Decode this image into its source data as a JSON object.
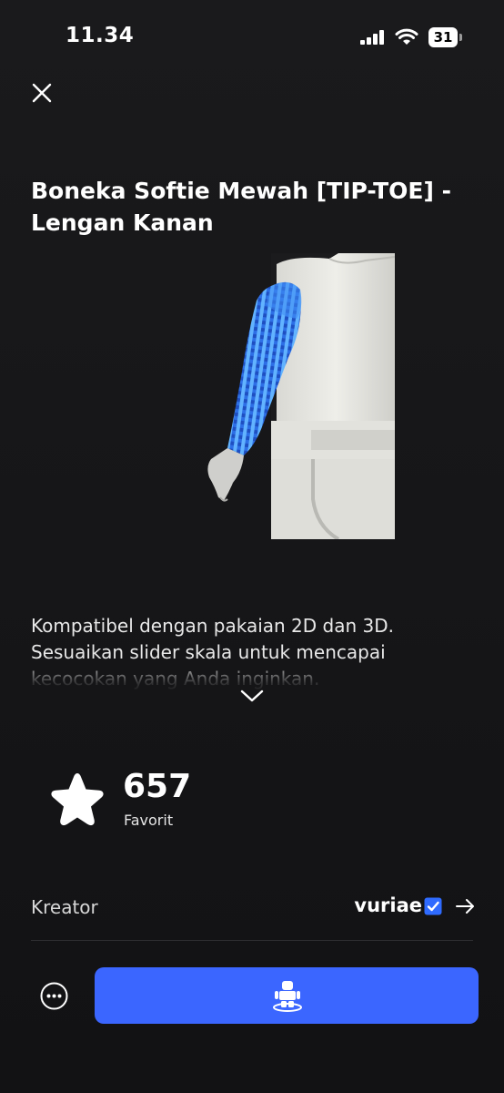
{
  "status_bar": {
    "time": "11.34",
    "battery": "31"
  },
  "item": {
    "title": "Boneka Softie Mewah [TIP-TOE] - Lengan Kanan",
    "description": "Kompatibel dengan pakaian 2D dan 3D. Sesuaikan slider skala untuk mencapai kecocokan yang Anda inginkan."
  },
  "favorites": {
    "count": "657",
    "label": "Favorit"
  },
  "creator": {
    "label": "Kreator",
    "name": "vuriae",
    "verified": true
  },
  "icons": {
    "close": "close-icon",
    "expand": "chevron-down-icon",
    "star": "star-icon",
    "verified": "verified-badge-icon",
    "arrow": "arrow-right-icon",
    "more": "more-icon",
    "try_on": "avatar-try-on-icon"
  },
  "colors": {
    "accent": "#3b66ff",
    "background": "#19191c",
    "verified": "#2f6bff"
  }
}
